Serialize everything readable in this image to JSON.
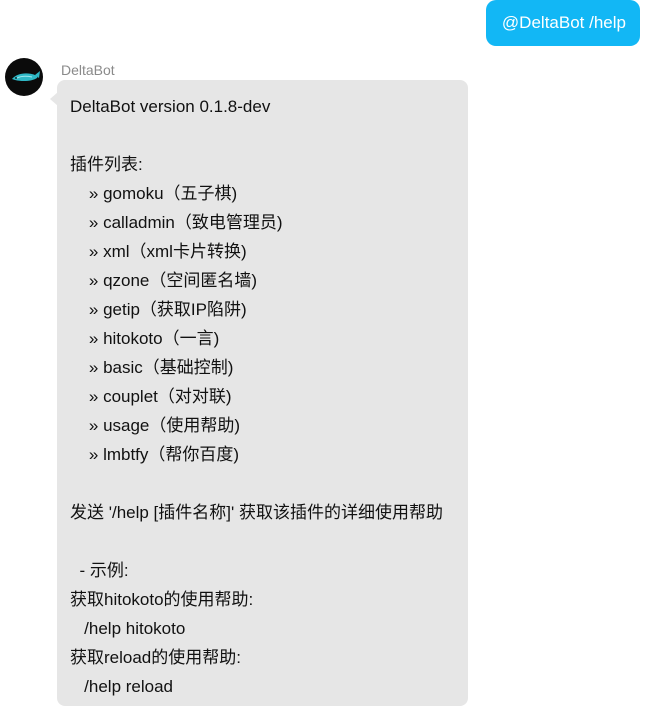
{
  "user_message": {
    "mention": "@DeltaBot",
    "command": "/help"
  },
  "bot": {
    "name": "DeltaBot",
    "avatar_icon": "fish-icon",
    "lines": [
      "DeltaBot version 0.1.8-dev",
      "",
      "插件列表:",
      "    » gomoku（五子棋)",
      "    » calladmin（致电管理员)",
      "    » xml（xml卡片转换)",
      "    » qzone（空间匿名墙)",
      "    » getip（获取IP陷阱)",
      "    » hitokoto（一言)",
      "    » basic（基础控制)",
      "    » couplet（对对联)",
      "    » usage（使用帮助)",
      "    » lmbtfy（帮你百度)",
      "",
      "发送 '/help [插件名称]' 获取该插件的详细使用帮助",
      "",
      "  - 示例:",
      "获取hitokoto的使用帮助:",
      "   /help hitokoto",
      "获取reload的使用帮助:",
      "   /help reload"
    ]
  },
  "colors": {
    "user_bubble": "#12b7f5",
    "bot_bubble": "#e6e6e6",
    "sender_name": "#8a8a8a"
  }
}
